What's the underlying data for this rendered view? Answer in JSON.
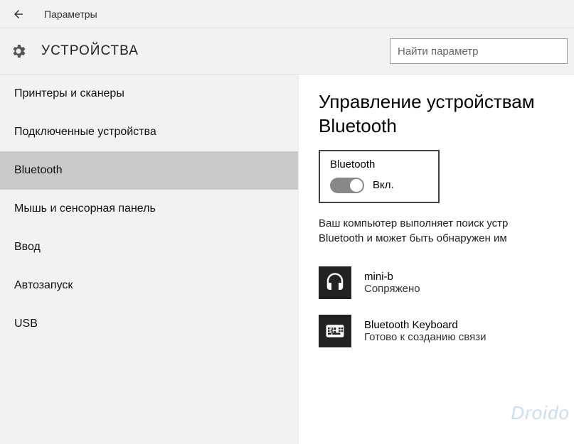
{
  "window": {
    "title": "Параметры"
  },
  "header": {
    "section": "УСТРОЙСТВА"
  },
  "search": {
    "placeholder": "Найти параметр"
  },
  "sidebar": {
    "items": [
      {
        "label": "Принтеры и сканеры",
        "selected": false
      },
      {
        "label": "Подключенные устройства",
        "selected": false
      },
      {
        "label": "Bluetooth",
        "selected": true
      },
      {
        "label": "Мышь и сенсорная панель",
        "selected": false
      },
      {
        "label": "Ввод",
        "selected": false
      },
      {
        "label": "Автозапуск",
        "selected": false
      },
      {
        "label": "USB",
        "selected": false
      }
    ]
  },
  "content": {
    "heading_l1": "Управление устройствам",
    "heading_l2": "Bluetooth",
    "toggle": {
      "label": "Bluetooth",
      "state": "Вкл.",
      "on": true
    },
    "description_l1": "Ваш компьютер выполняет поиск устр",
    "description_l2": "Bluetooth и может быть обнаружен им",
    "devices": [
      {
        "icon": "headset",
        "name": "mini-b",
        "status": "Сопряжено"
      },
      {
        "icon": "keyboard",
        "name": "Bluetooth Keyboard",
        "status": "Готово к созданию связи"
      }
    ]
  },
  "watermark": "Droido"
}
